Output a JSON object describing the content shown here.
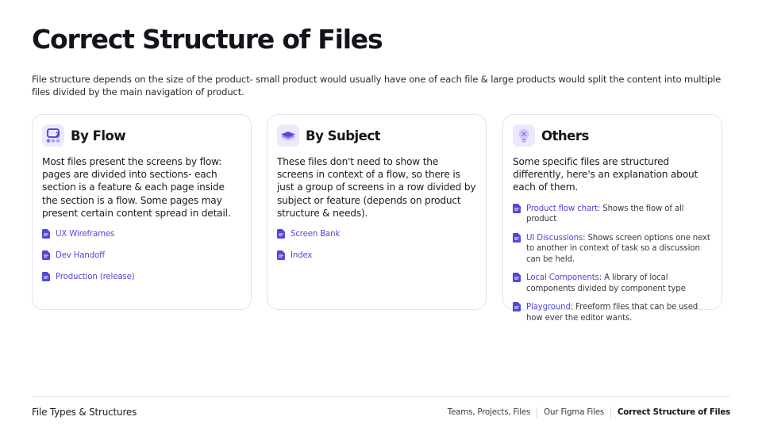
{
  "page": {
    "title": "Correct Structure of Files",
    "intro": "File structure depends on the size of the product- small product would usually have one of each file & large products would split the content into multiple files divided by the main navigation of product."
  },
  "colors": {
    "accent": "#5148d9",
    "highlight": "#6fd3b4",
    "icon_bg": "#ebe8ff"
  },
  "cards": [
    {
      "title": "By Flow",
      "icon": "flow-icon",
      "description": "Most files present the screens by flow: pages are divided into sections- each section is a feature & each page inside the section is a flow. Some pages may present certain content spread in detail.",
      "links": [
        {
          "label": "UX Wireframes",
          "rest": ""
        },
        {
          "label": "Dev Handoff",
          "rest": ""
        },
        {
          "label": "Production (release)",
          "rest": ""
        }
      ]
    },
    {
      "title": "By Subject",
      "icon": "layers-icon",
      "description": "These files don't need to show the screens in context of a flow, so there is just a group of screens in a row divided by subject or feature (depends on product structure & needs).",
      "links": [
        {
          "label": "Screen Bank",
          "rest": ""
        },
        {
          "label": "Index",
          "rest": ""
        }
      ]
    },
    {
      "title": "Others",
      "icon": "lightbulb-icon",
      "description": "Some specific files are structured differently, here's an explanation about each of them.",
      "links": [
        {
          "label": "Product flow chart:",
          "rest": " Shows the flow of all product"
        },
        {
          "label": "UI Discussions:",
          "rest": " Shows screen options one next to another in context of task so a discussion can be held."
        },
        {
          "label": "Local Components:",
          "rest": " A library of local components divided by component type"
        },
        {
          "label": "Playground:",
          "rest": " Freeform files that can be used how ever the editor wants."
        }
      ]
    }
  ],
  "footer": {
    "section": "File Types & Structures",
    "nav": [
      "Teams, Projects, Files",
      "Our Figma Files",
      "Correct Structure of Files"
    ],
    "active": "Correct Structure of Files"
  }
}
